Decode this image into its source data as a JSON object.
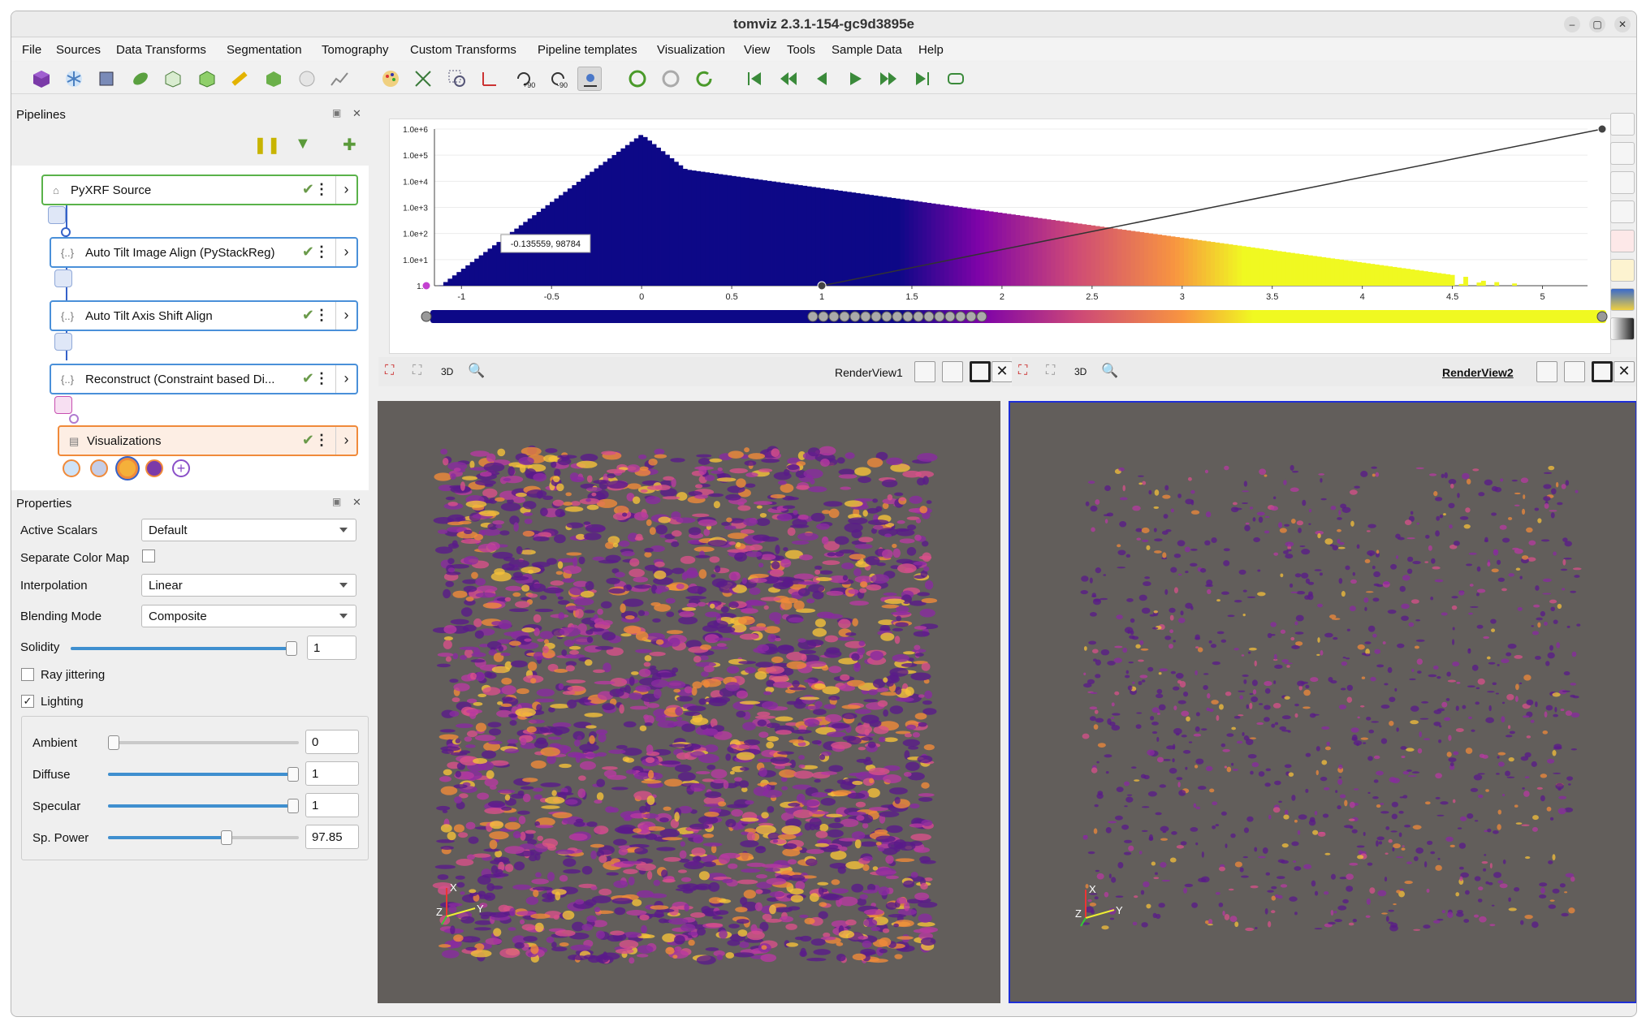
{
  "window": {
    "title": "tomviz 2.3.1-154-gc9d3895e"
  },
  "menu": [
    "File",
    "Sources",
    "Data Transforms",
    "Segmentation",
    "Tomography",
    "Custom Transforms",
    "Pipeline templates",
    "Visualization",
    "View",
    "Tools",
    "Sample Data",
    "Help"
  ],
  "toolbar": {
    "icons": [
      "cube-icon",
      "snowflake-icon",
      "box-icon",
      "leaf-icon",
      "cube-outline-icon",
      "cube-green-icon",
      "ruler-icon",
      "cube-rotate-icon",
      "molecule-icon",
      "line-chart-icon",
      "palette-icon",
      "fit-icon",
      "zoom-box-icon",
      "axis-x-icon",
      "rotate-plus90-icon",
      "rotate-minus90-icon",
      "center-icon",
      "reset-icon",
      "reset-alt-icon",
      "refresh-icon",
      "first-frame-icon",
      "prev-frame-icon",
      "step-back-icon",
      "play-icon",
      "step-forward-icon",
      "last-frame-icon",
      "loop-icon"
    ],
    "rotate_plus": "+90",
    "rotate_minus": "-90"
  },
  "pipelines": {
    "title": "Pipelines",
    "nodes": [
      {
        "label": "PyXRF Source"
      },
      {
        "label": "Auto Tilt Image Align (PyStackReg)"
      },
      {
        "label": "Auto Tilt Axis Shift Align"
      },
      {
        "label": "Reconstruct (Constraint based Di..."
      },
      {
        "label": "Visualizations"
      }
    ]
  },
  "properties": {
    "title": "Properties",
    "active_scalars_label": "Active Scalars",
    "active_scalars_value": "Default",
    "separate_color_map_label": "Separate Color Map",
    "interpolation_label": "Interpolation",
    "interpolation_value": "Linear",
    "blending_label": "Blending Mode",
    "blending_value": "Composite",
    "solidity_label": "Solidity",
    "solidity_value": "1",
    "solidity_level": 1.0,
    "ray_jittering_label": "Ray jittering",
    "ray_jittering_checked": false,
    "lighting_label": "Lighting",
    "lighting_checked": true,
    "ambient_label": "Ambient",
    "ambient_value": "0",
    "ambient_level": 0.0,
    "diffuse_label": "Diffuse",
    "diffuse_value": "1",
    "diffuse_level": 1.0,
    "specular_label": "Specular",
    "specular_value": "1",
    "specular_level": 1.0,
    "sp_power_label": "Sp. Power",
    "sp_power_value": "97.85",
    "sp_power_level": 0.63
  },
  "histogram": {
    "y_ticks": [
      "1.0e+6",
      "1.0e+5",
      "1.0e+4",
      "1.0e+3",
      "1.0e+2",
      "1.0e+1",
      "1.0"
    ],
    "x_ticks": [
      "-1",
      "-0.5",
      "0",
      "0.5",
      "1",
      "1.5",
      "2",
      "2.5",
      "3",
      "3.5",
      "4",
      "4.5",
      "5"
    ],
    "tooltip": "-0.135559, 98784",
    "colors": {
      "dark": "#0d0887",
      "mid": "#cc4778",
      "bright": "#f0f921"
    }
  },
  "views": {
    "left": {
      "name": "RenderView1",
      "mode": "3D"
    },
    "right": {
      "name": "RenderView2",
      "mode": "3D"
    },
    "axis_x": "X",
    "axis_y": "Y",
    "axis_z": "Z"
  }
}
